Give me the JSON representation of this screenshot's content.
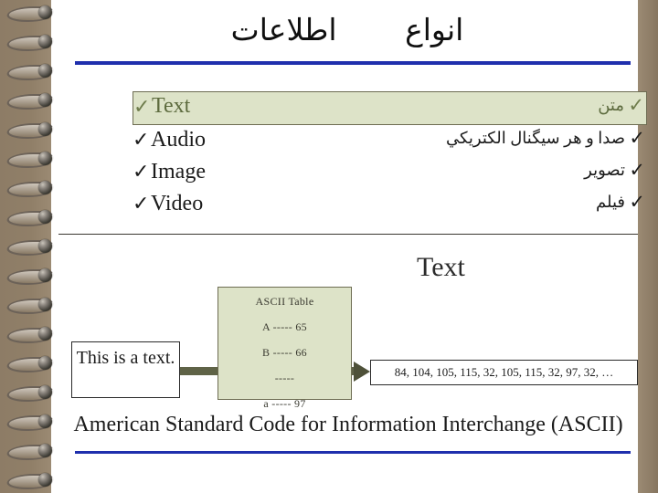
{
  "slide": {
    "title_right": "انواع",
    "title_left": "اطلاعات",
    "section_heading": "Text",
    "caption": "American Standard Code for Information Interchange (ASCII)"
  },
  "colors": {
    "accent_rule": "#1f2fad",
    "highlight_fill": "#dde3c8",
    "highlight_border": "#6d6c52",
    "highlight_text": "#5d6b3e",
    "arrow": "#5f6347",
    "paper": "#ffffff",
    "binder": "#8d7c66"
  },
  "list": {
    "check_glyph": "✓",
    "items": [
      {
        "en": "Text",
        "fa": "متن",
        "highlighted": true
      },
      {
        "en": "Audio",
        "fa": "صدا و هر سیگنال الکتریکي",
        "highlighted": false
      },
      {
        "en": "Image",
        "fa": "تصویر",
        "highlighted": false
      },
      {
        "en": "Video",
        "fa": "فیلم",
        "highlighted": false
      }
    ]
  },
  "diagram": {
    "input_box": "This is a text.",
    "ascii_table": {
      "header": "ASCII Table",
      "rows": [
        "A  -----  65",
        "B  -----  66",
        "-----",
        "a  -----  97"
      ]
    },
    "output_box": "84, 104, 105, 115, 32, 105, 115, 32, 97, 32, …"
  }
}
